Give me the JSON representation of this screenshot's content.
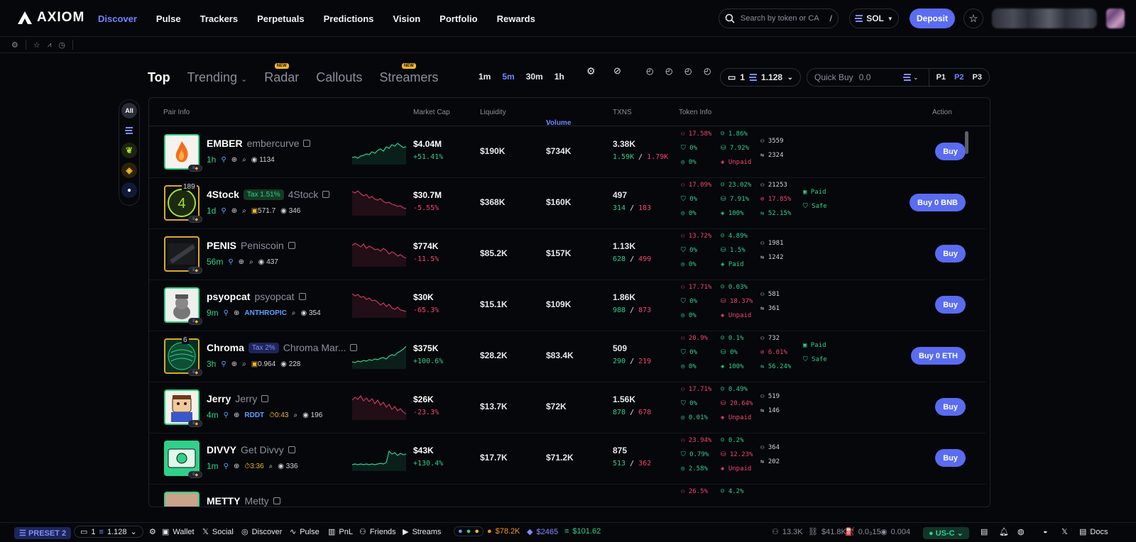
{
  "brand": {
    "name": "AXIOM"
  },
  "nav": [
    {
      "label": "Discover",
      "active": true
    },
    {
      "label": "Pulse"
    },
    {
      "label": "Trackers"
    },
    {
      "label": "Perpetuals"
    },
    {
      "label": "Predictions"
    },
    {
      "label": "Vision"
    },
    {
      "label": "Portfolio"
    },
    {
      "label": "Rewards"
    }
  ],
  "search": {
    "placeholder": "Search by token or CA",
    "shortcut": "/"
  },
  "chain": {
    "label": "SOL"
  },
  "deposit_label": "Deposit",
  "tabs": [
    {
      "label": "Top",
      "active": true
    },
    {
      "label": "Trending"
    },
    {
      "label": "Radar",
      "badge": "NEW"
    },
    {
      "label": "Callouts"
    },
    {
      "label": "Streamers",
      "badge": "NEW"
    }
  ],
  "timeframes": [
    "1m",
    "5m",
    "30m",
    "1h"
  ],
  "active_timeframe": "5m",
  "wallet_select": {
    "count": "1",
    "balance": "1.128"
  },
  "quick_buy": {
    "label": "Quick Buy",
    "value": "0.0"
  },
  "presets": [
    "P1",
    "P2",
    "P3"
  ],
  "active_preset": "P2",
  "rail": {
    "all_label": "All"
  },
  "columns": {
    "pair_info": "Pair Info",
    "market_cap": "Market Cap",
    "liquidity": "Liquidity",
    "volume": "Volume",
    "txns": "TXNS",
    "token_info": "Token Info",
    "action": "Action"
  },
  "rows": [
    {
      "name": "EMBER",
      "full": "embercurve",
      "age": "1h",
      "views": "1134",
      "extra": "",
      "extra2": "",
      "holders": "",
      "tax": "",
      "mcap": "$4.04M",
      "mchg": "+51.41%",
      "up": true,
      "liq": "$190K",
      "vol": "$734K",
      "txns": "3.38K",
      "buys": "1.59K",
      "sells": "1.79K",
      "i1": "17.58%",
      "i2": "1.86%",
      "i3": "0%",
      "i4": "7.92%",
      "i5": "0%",
      "i6": "Unpaid",
      "h1": "3559",
      "h2": "2324",
      "extra_info": [],
      "buy": "Buy"
    },
    {
      "name": "4Stock",
      "full": "4Stock",
      "age": "1d",
      "views": "346",
      "extra": "571.7",
      "extra2": "",
      "holders": "189",
      "tax": "Tax 1.51%",
      "mcap": "$30.7M",
      "mchg": "-5.55%",
      "up": false,
      "liq": "$368K",
      "vol": "$160K",
      "txns": "497",
      "buys": "314",
      "sells": "183",
      "i1": "17.09%",
      "i2": "23.02%",
      "i3": "0%",
      "i4": "7.91%",
      "i5": "0%",
      "i6": "100%",
      "h1": "21253",
      "h2": "17.85%",
      "h3": "52.15%",
      "extra_info": [
        "Paid",
        "Safe"
      ],
      "buy": "Buy 0 BNB"
    },
    {
      "name": "PENIS",
      "full": "Peniscoin",
      "age": "56m",
      "views": "437",
      "extra": "",
      "extra2": "",
      "holders": "",
      "tax": "",
      "mcap": "$774K",
      "mchg": "-11.5%",
      "up": false,
      "liq": "$85.2K",
      "vol": "$157K",
      "txns": "1.13K",
      "buys": "628",
      "sells": "499",
      "i1": "13.72%",
      "i2": "4.89%",
      "i3": "0%",
      "i4": "1.5%",
      "i5": "0%",
      "i6": "Paid",
      "h1": "1981",
      "h2": "1242",
      "extra_info": [],
      "buy": "Buy"
    },
    {
      "name": "psyopcat",
      "full": "psyopcat",
      "age": "9m",
      "views": "354",
      "extra": "ANTHROPIC",
      "extra2": "",
      "holders": "",
      "tax": "",
      "mcap": "$30K",
      "mchg": "-65.3%",
      "up": false,
      "liq": "$15.1K",
      "vol": "$109K",
      "txns": "1.86K",
      "buys": "988",
      "sells": "873",
      "i1": "17.71%",
      "i2": "0.03%",
      "i3": "0%",
      "i4": "18.37%",
      "i5": "0%",
      "i6": "Unpaid",
      "h1": "581",
      "h2": "361",
      "extra_info": [],
      "buy": "Buy"
    },
    {
      "name": "Chroma",
      "full": "Chroma Mar...",
      "age": "3h",
      "views": "228",
      "extra": "0.964",
      "extra2": "",
      "holders": "6",
      "tax": "Tax 2%",
      "mcap": "$375K",
      "mchg": "+100.6%",
      "up": true,
      "liq": "$28.2K",
      "vol": "$83.4K",
      "txns": "509",
      "buys": "290",
      "sells": "219",
      "i1": "20.9%",
      "i2": "0.1%",
      "i3": "0%",
      "i4": "0%",
      "i5": "0%",
      "i6": "100%",
      "h1": "732",
      "h2": "6.01%",
      "h3": "56.24%",
      "extra_info": [
        "Paid",
        "Safe"
      ],
      "buy": "Buy 0 ETH"
    },
    {
      "name": "Jerry",
      "full": "Jerry",
      "age": "4m",
      "views": "196",
      "extra": "RDDT",
      "extra2": "0:43",
      "holders": "",
      "tax": "",
      "mcap": "$26K",
      "mchg": "-23.3%",
      "up": false,
      "liq": "$13.7K",
      "vol": "$72K",
      "txns": "1.56K",
      "buys": "878",
      "sells": "678",
      "i1": "17.71%",
      "i2": "0.49%",
      "i3": "0%",
      "i4": "20.64%",
      "i5": "0.01%",
      "i6": "Unpaid",
      "h1": "519",
      "h2": "146",
      "extra_info": [],
      "buy": "Buy"
    },
    {
      "name": "DIVVY",
      "full": "Get Divvy",
      "age": "1m",
      "views": "336",
      "extra": "",
      "extra2": "3:36",
      "holders": "",
      "tax": "",
      "mcap": "$43K",
      "mchg": "+130.4%",
      "up": true,
      "liq": "$17.7K",
      "vol": "$71.2K",
      "txns": "875",
      "buys": "513",
      "sells": "362",
      "i1": "23.94%",
      "i2": "0.2%",
      "i3": "0.79%",
      "i4": "12.23%",
      "i5": "2.58%",
      "i6": "Unpaid",
      "h1": "364",
      "h2": "202",
      "extra_info": [],
      "buy": "Buy"
    },
    {
      "name": "METTY",
      "full": "Metty",
      "age": "",
      "views": "",
      "extra": "",
      "extra2": "",
      "holders": "",
      "tax": "",
      "mcap": "",
      "mchg": "",
      "up": true,
      "liq": "",
      "vol": "",
      "txns": "",
      "buys": "",
      "sells": "",
      "i1": "26.5%",
      "i2": "4.2%",
      "i3": "",
      "i4": "",
      "i5": "",
      "i6": "",
      "h1": "",
      "h2": "",
      "extra_info": [],
      "buy": ""
    }
  ],
  "bottombar": {
    "preset": "PRESET 2",
    "wallet_count": "1",
    "wallet_balance": "1.128",
    "links": [
      "Wallet",
      "Social",
      "Discover",
      "Pulse",
      "PnL",
      "Friends",
      "Streams"
    ],
    "btc": "$78.2K",
    "eth": "$2465",
    "sol": "$101.62",
    "stat1": "13.3K",
    "stat2": "$41.8K",
    "stat3": "0.0₃15",
    "stat4": "0.004",
    "region": "US-C",
    "docs": "Docs"
  }
}
